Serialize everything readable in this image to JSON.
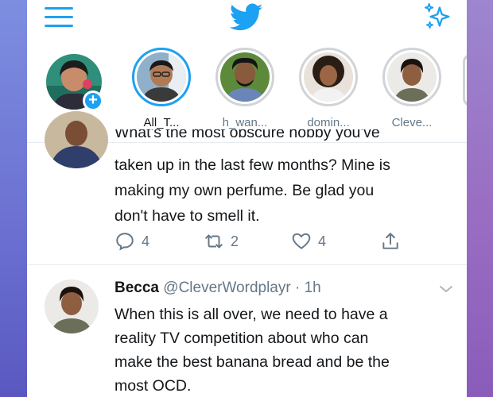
{
  "colors": {
    "accent": "#1da1f2",
    "text": "#14171a",
    "muted": "#657786"
  },
  "header": {
    "logo_icon": "twitter-bird-icon",
    "menu_icon": "hamburger-menu-icon",
    "right_icon": "sparkle-icon"
  },
  "fleets": [
    {
      "label": "Add"
    },
    {
      "label": "All_T..."
    },
    {
      "label": "h_wan..."
    },
    {
      "label": "domin..."
    },
    {
      "label": "Cleve..."
    }
  ],
  "tweet1": {
    "lines": [
      "What's the most obscure hobby you've",
      "taken up in the last few months? Mine is",
      "making my own perfume. Be glad you",
      "don't have to smell it."
    ],
    "reply_count": "4",
    "retweet_count": "2",
    "like_count": "4"
  },
  "tweet2": {
    "name": "Becca",
    "handle": "@CleverWordplayr",
    "dot": "·",
    "time": "1h",
    "lines": [
      "When this is all over, we need to have a",
      "reality TV competition about who can",
      "make the best banana bread and be the",
      "most OCD."
    ]
  }
}
